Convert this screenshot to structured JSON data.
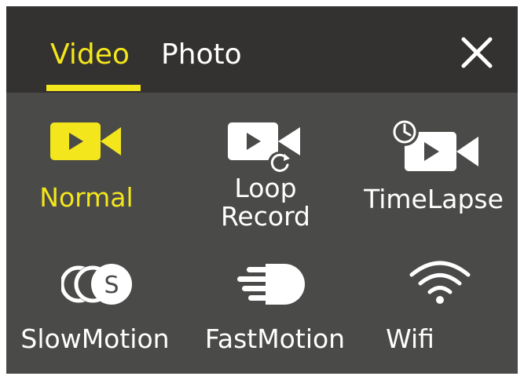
{
  "header": {
    "tabs": [
      {
        "label": "Video",
        "active": true
      },
      {
        "label": "Photo",
        "active": false
      }
    ],
    "close_icon": "close-icon"
  },
  "modes": [
    {
      "label": "Normal",
      "icon": "video-camera-icon",
      "active": true
    },
    {
      "label_line1": "Loop",
      "label_line2": "Record",
      "icon": "loop-record-icon",
      "active": false
    },
    {
      "label": "TimeLapse",
      "icon": "timelapse-icon",
      "active": false
    },
    {
      "label": "SlowMotion",
      "icon": "slow-motion-icon",
      "active": false
    },
    {
      "label": "FastMotion",
      "icon": "fast-motion-icon",
      "active": false
    },
    {
      "label": "Wifi",
      "icon": "wifi-icon",
      "active": false
    }
  ],
  "colors": {
    "accent": "#f4e61c",
    "header_bg": "#333230",
    "body_bg": "#4a4a49",
    "text": "#ffffff"
  }
}
